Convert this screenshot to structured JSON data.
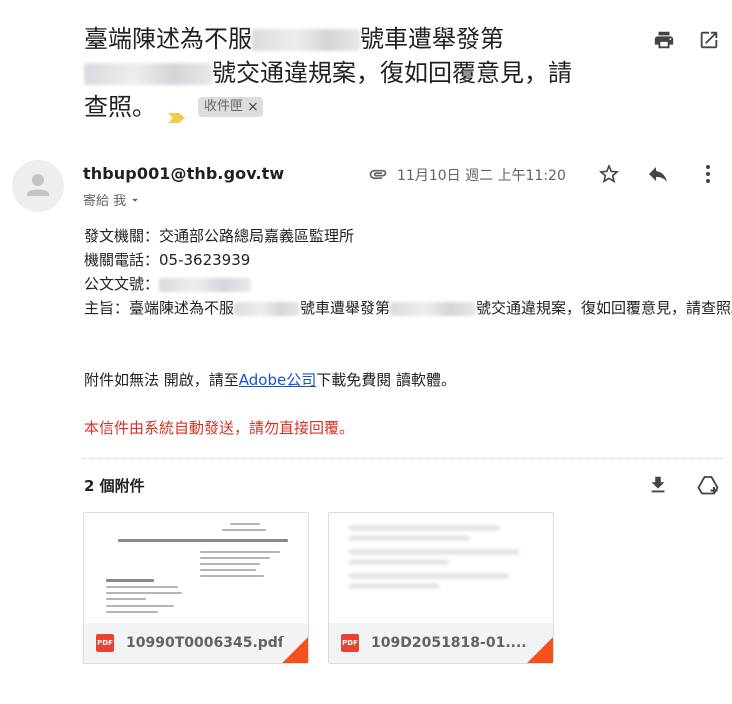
{
  "subject": {
    "part1": "臺端陳述為不服",
    "part2": "號車遭舉發第",
    "part3": "號交通違規案，復如回覆意見，請",
    "part4": "查照。",
    "label": "收件匣",
    "label_remove": "×"
  },
  "toolbar": {
    "print_icon": "print-icon",
    "popout_icon": "open-in-new-icon"
  },
  "sender": {
    "email": "thbup001@thb.gov.tw",
    "to": "寄給 我",
    "date": "11月10日 週二 上午11:20"
  },
  "body": {
    "line1": "發文機關：交通部公路總局嘉義區監理所",
    "line2": "機關電話：05-3623939",
    "line3": "公文文號：",
    "line4_a": "主旨：臺端陳述為不服",
    "line4_b": "號車遭舉發第",
    "line4_c": "號交通違規案，復如回覆意見，請查照。",
    "notice_a": "附件如無法 開啟，請至",
    "notice_link": "Adobe公司",
    "notice_b": "下載免費閱 讀軟體。",
    "auto_notice": "本信件由系統自動發送，請勿直接回覆。"
  },
  "attachments": {
    "title": "2 個附件",
    "items": [
      {
        "name": "10990T0006345.pdf",
        "type": "PDF"
      },
      {
        "name": "109D2051818-01....",
        "type": "PDF"
      }
    ]
  },
  "colors": {
    "link": "#1155cc",
    "red": "#d93025",
    "pdf": "#e94235",
    "corner": "#f4511e",
    "important": "#f2c94c"
  }
}
